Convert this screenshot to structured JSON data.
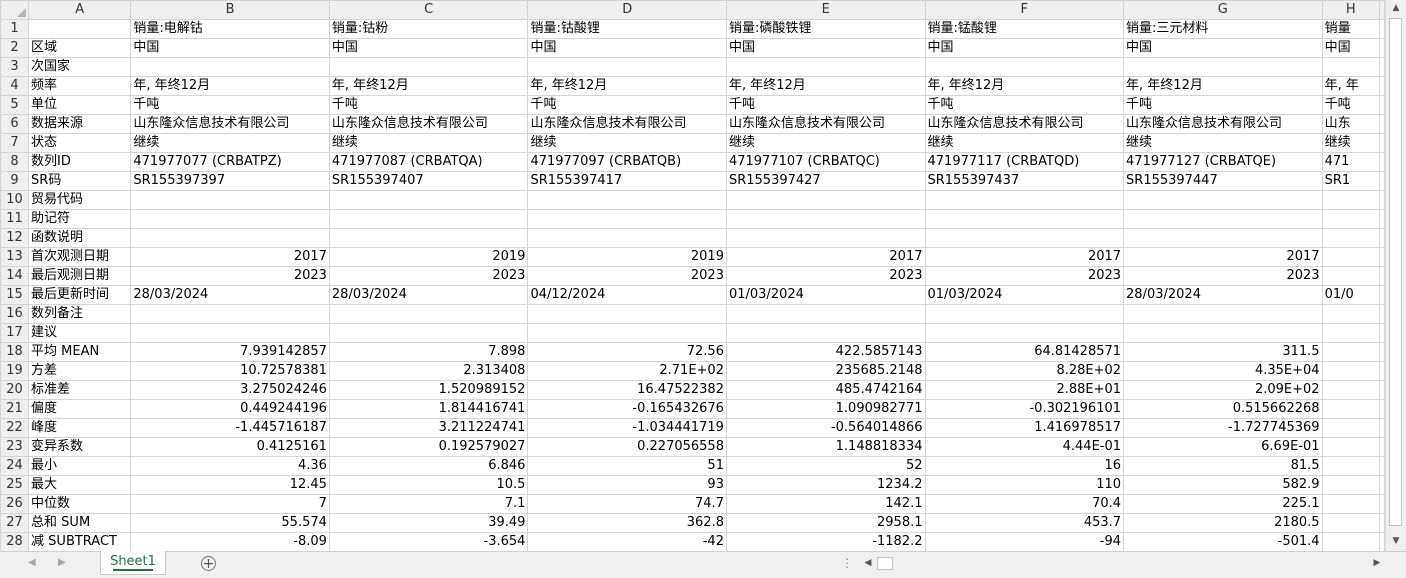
{
  "columns": [
    "A",
    "B",
    "C",
    "D",
    "E",
    "F",
    "G",
    "H"
  ],
  "rows": [
    {
      "n": "1",
      "a": "",
      "cells": [
        "销量:电解钴",
        "销量:钴粉",
        "销量:钴酸锂",
        "销量:磷酸铁锂",
        "销量:锰酸锂",
        "销量:三元材料",
        "销量"
      ]
    },
    {
      "n": "2",
      "a": "区域",
      "cells": [
        "中国",
        "中国",
        "中国",
        "中国",
        "中国",
        "中国",
        "中国"
      ]
    },
    {
      "n": "3",
      "a": "次国家",
      "cells": [
        "",
        "",
        "",
        "",
        "",
        "",
        ""
      ]
    },
    {
      "n": "4",
      "a": "频率",
      "cells": [
        "年, 年终12月",
        "年, 年终12月",
        "年, 年终12月",
        "年, 年终12月",
        "年, 年终12月",
        "年, 年终12月",
        "年, 年"
      ]
    },
    {
      "n": "5",
      "a": "单位",
      "cells": [
        "千吨",
        "千吨",
        "千吨",
        "千吨",
        "千吨",
        "千吨",
        "千吨"
      ]
    },
    {
      "n": "6",
      "a": "数据来源",
      "cells": [
        "山东隆众信息技术有限公司",
        "山东隆众信息技术有限公司",
        "山东隆众信息技术有限公司",
        "山东隆众信息技术有限公司",
        "山东隆众信息技术有限公司",
        "山东隆众信息技术有限公司",
        "山东"
      ]
    },
    {
      "n": "7",
      "a": "状态",
      "cells": [
        "继续",
        "继续",
        "继续",
        "继续",
        "继续",
        "继续",
        "继续"
      ]
    },
    {
      "n": "8",
      "a": "数列ID",
      "cells": [
        "471977077 (CRBATPZ)",
        "471977087 (CRBATQA)",
        "471977097 (CRBATQB)",
        "471977107 (CRBATQC)",
        "471977117 (CRBATQD)",
        "471977127 (CRBATQE)",
        "471"
      ]
    },
    {
      "n": "9",
      "a": "SR码",
      "cells": [
        "SR155397397",
        "SR155397407",
        "SR155397417",
        "SR155397427",
        "SR155397437",
        "SR155397447",
        "SR1"
      ]
    },
    {
      "n": "10",
      "a": "贸易代码",
      "cells": [
        "",
        "",
        "",
        "",
        "",
        "",
        ""
      ]
    },
    {
      "n": "11",
      "a": "助记符",
      "cells": [
        "",
        "",
        "",
        "",
        "",
        "",
        ""
      ]
    },
    {
      "n": "12",
      "a": "函数说明",
      "cells": [
        "",
        "",
        "",
        "",
        "",
        "",
        ""
      ]
    },
    {
      "n": "13",
      "a": "首次观测日期",
      "num": true,
      "cells": [
        "2017",
        "2019",
        "2019",
        "2017",
        "2017",
        "2017",
        ""
      ]
    },
    {
      "n": "14",
      "a": "最后观测日期",
      "num": true,
      "cells": [
        "2023",
        "2023",
        "2023",
        "2023",
        "2023",
        "2023",
        ""
      ]
    },
    {
      "n": "15",
      "a": "最后更新时间",
      "cells": [
        "28/03/2024",
        "28/03/2024",
        "04/12/2024",
        "01/03/2024",
        "01/03/2024",
        "28/03/2024",
        "01/0"
      ]
    },
    {
      "n": "16",
      "a": "数列备注",
      "cells": [
        "",
        "",
        "",
        "",
        "",
        "",
        ""
      ]
    },
    {
      "n": "17",
      "a": "建议",
      "cells": [
        "",
        "",
        "",
        "",
        "",
        "",
        ""
      ]
    },
    {
      "n": "18",
      "a": "平均 MEAN",
      "num": true,
      "cells": [
        "7.939142857",
        "7.898",
        "72.56",
        "422.5857143",
        "64.81428571",
        "311.5",
        ""
      ]
    },
    {
      "n": "19",
      "a": "方差",
      "num": true,
      "cells": [
        "10.72578381",
        "2.313408",
        "2.71E+02",
        "235685.2148",
        "8.28E+02",
        "4.35E+04",
        ""
      ]
    },
    {
      "n": "20",
      "a": "标准差",
      "num": true,
      "cells": [
        "3.275024246",
        "1.520989152",
        "16.47522382",
        "485.4742164",
        "2.88E+01",
        "2.09E+02",
        ""
      ]
    },
    {
      "n": "21",
      "a": "偏度",
      "num": true,
      "cells": [
        "0.449244196",
        "1.814416741",
        "-0.165432676",
        "1.090982771",
        "-0.302196101",
        "0.515662268",
        ""
      ]
    },
    {
      "n": "22",
      "a": "峰度",
      "num": true,
      "cells": [
        "-1.445716187",
        "3.211224741",
        "-1.034441719",
        "-0.564014866",
        "1.416978517",
        "-1.727745369",
        ""
      ]
    },
    {
      "n": "23",
      "a": "变异系数",
      "num": true,
      "cells": [
        "0.4125161",
        "0.192579027",
        "0.227056558",
        "1.148818334",
        "4.44E-01",
        "6.69E-01",
        ""
      ]
    },
    {
      "n": "24",
      "a": "最小",
      "num": true,
      "cells": [
        "4.36",
        "6.846",
        "51",
        "52",
        "16",
        "81.5",
        ""
      ]
    },
    {
      "n": "25",
      "a": "最大",
      "num": true,
      "cells": [
        "12.45",
        "10.5",
        "93",
        "1234.2",
        "110",
        "582.9",
        ""
      ]
    },
    {
      "n": "26",
      "a": "中位数",
      "num": true,
      "cells": [
        "7",
        "7.1",
        "74.7",
        "142.1",
        "70.4",
        "225.1",
        ""
      ]
    },
    {
      "n": "27",
      "a": "总和 SUM",
      "num": true,
      "cells": [
        "55.574",
        "39.49",
        "362.8",
        "2958.1",
        "453.7",
        "2180.5",
        ""
      ]
    },
    {
      "n": "28",
      "a": "减 SUBTRACT",
      "num": true,
      "cells": [
        "-8.09",
        "-3.654",
        "-42",
        "-1182.2",
        "-94",
        "-501.4",
        ""
      ]
    }
  ],
  "sheet_tab": "Sheet1",
  "icons": {
    "add_sheet": "plus-circle-icon",
    "scroll_up": "arrow-up-icon",
    "scroll_down": "arrow-down-icon",
    "scroll_left": "arrow-left-icon",
    "scroll_right": "arrow-right-icon"
  },
  "colors": {
    "tab_accent": "#217346",
    "header_bg": "#efefef",
    "gridline": "#d4d4d4"
  }
}
